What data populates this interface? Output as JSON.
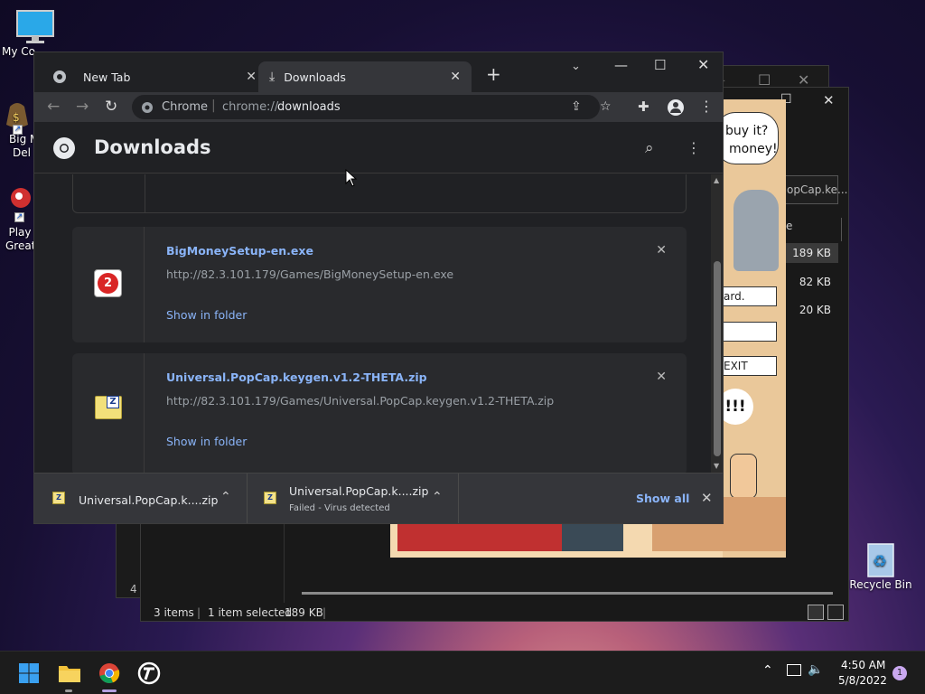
{
  "desktop": {
    "icons": [
      {
        "label": "My Co"
      },
      {
        "label": "Big M\nDel"
      },
      {
        "label": "Play\nGreat "
      },
      {
        "label": "Recycle Bin"
      }
    ]
  },
  "explorer": {
    "search_partial": "opCap.ke...",
    "col_partial": "e",
    "rows": [
      {
        "size": "189 KB"
      },
      {
        "size": "82 KB"
      },
      {
        "size": "20 KB"
      }
    ],
    "status": {
      "items": "3 items",
      "selected": "1 item selected",
      "size": "189 KB"
    },
    "back_status": "4 i"
  },
  "comic": {
    "bubble1": "buy it?",
    "bubble2": "money!",
    "btn1": "ard.",
    "btn3": "EXIT",
    "shout": "!!!"
  },
  "chrome": {
    "tabs": [
      {
        "label": "New Tab"
      },
      {
        "label": "Downloads"
      }
    ],
    "omnibox": {
      "site": "Chrome",
      "url_prefix": "chrome://",
      "url_path": "downloads"
    },
    "page_title": "Downloads",
    "downloads": [
      {
        "name": "BigMoneySetup-en.exe",
        "url": "http://82.3.101.179/Games/BigMoneySetup-en.exe",
        "action": "Show in folder"
      },
      {
        "name": "Universal.PopCap.keygen.v1.2-THETA.zip",
        "url": "http://82.3.101.179/Games/Universal.PopCap.keygen.v1.2-THETA.zip",
        "action": "Show in folder"
      }
    ],
    "shelf": {
      "item1": {
        "name": "Universal.PopCap.k....zip"
      },
      "item2": {
        "name": "Universal.PopCap.k....zip",
        "status": "Failed - Virus detected"
      },
      "show_all": "Show all"
    }
  },
  "taskbar": {
    "time": "4:50 AM",
    "date": "5/8/2022",
    "notifications": "1"
  }
}
